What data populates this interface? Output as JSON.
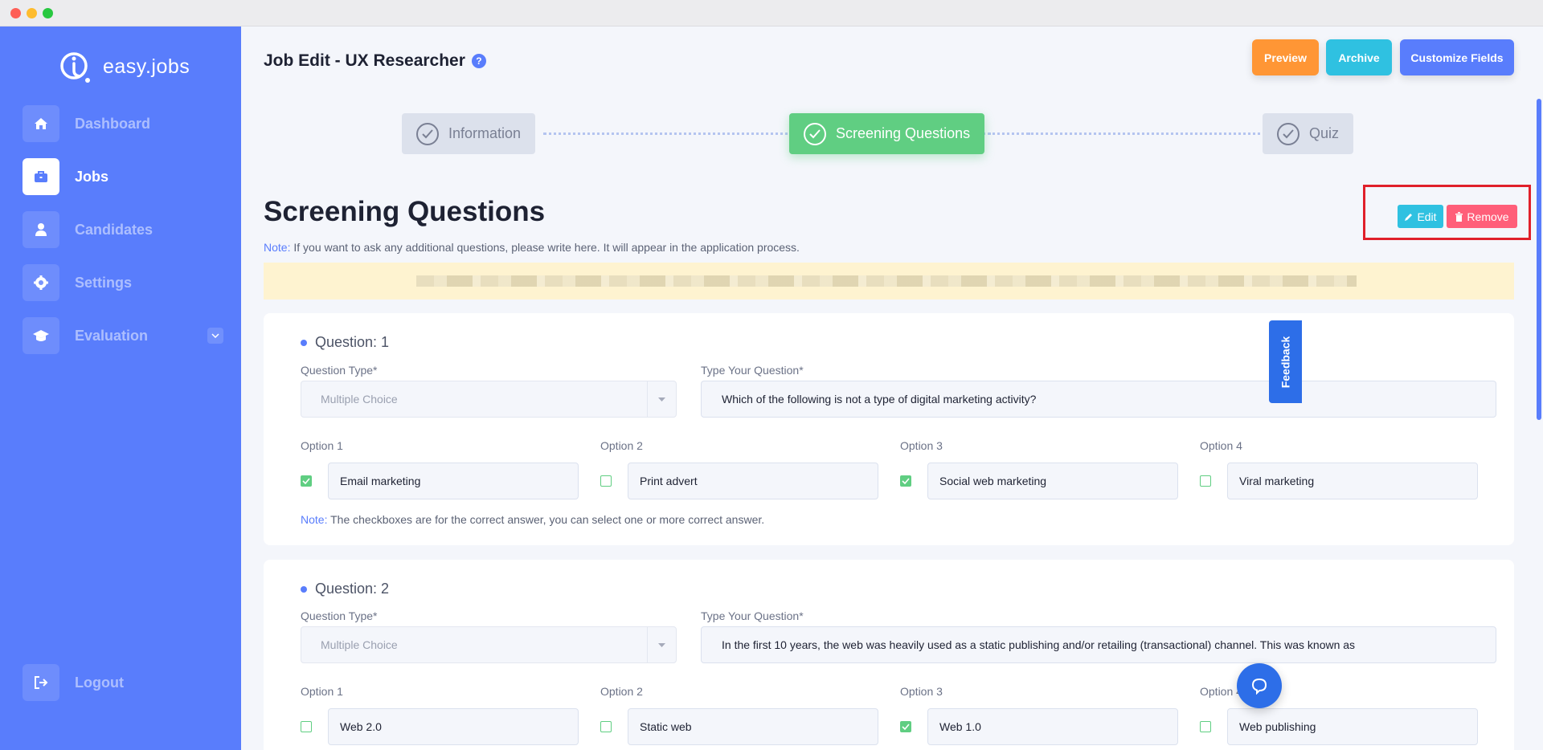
{
  "brand": {
    "name": "easy.jobs"
  },
  "sidebar": {
    "items": [
      {
        "label": "Dashboard",
        "icon": "home-icon"
      },
      {
        "label": "Jobs",
        "icon": "briefcase-icon"
      },
      {
        "label": "Candidates",
        "icon": "user-icon"
      },
      {
        "label": "Settings",
        "icon": "gear-icon"
      },
      {
        "label": "Evaluation",
        "icon": "graduation-cap-icon"
      }
    ],
    "logout": "Logout",
    "active": "Jobs"
  },
  "header": {
    "title": "Job Edit - UX Researcher",
    "help": "?",
    "buttons": {
      "preview": "Preview",
      "archive": "Archive",
      "customize": "Customize Fields"
    }
  },
  "steps": [
    {
      "label": "Information",
      "state": "inactive"
    },
    {
      "label": "Screening Questions",
      "state": "active"
    },
    {
      "label": "Quiz",
      "state": "inactive"
    }
  ],
  "section": {
    "title": "Screening Questions",
    "note_label": "Note:",
    "note_text": " If you want to ask any additional questions, please write here. It will appear in the application process.",
    "edit": "Edit",
    "remove": "Remove"
  },
  "questions": [
    {
      "heading": "Question: 1",
      "type_label": "Question Type*",
      "type_value": "Multiple Choice",
      "question_label": "Type Your Question*",
      "question_value": "Which of the following is not a type of digital marketing activity?",
      "options": [
        {
          "label": "Option 1",
          "value": "Email marketing",
          "checked": true
        },
        {
          "label": "Option 2",
          "value": "Print advert",
          "checked": false
        },
        {
          "label": "Option 3",
          "value": "Social web marketing",
          "checked": true
        },
        {
          "label": "Option 4",
          "value": "Viral marketing",
          "checked": false
        }
      ],
      "note_label": "Note:",
      "note_text": " The checkboxes are for the correct answer, you can select one or more correct answer."
    },
    {
      "heading": "Question: 2",
      "type_label": "Question Type*",
      "type_value": "Multiple Choice",
      "question_label": "Type Your Question*",
      "question_value": "In the first 10 years, the web was heavily used as a static publishing and/or retailing (transactional) channel. This was known as",
      "options": [
        {
          "label": "Option 1",
          "value": "Web 2.0",
          "checked": false
        },
        {
          "label": "Option 2",
          "value": "Static web",
          "checked": false
        },
        {
          "label": "Option 3",
          "value": "Web 1.0",
          "checked": true
        },
        {
          "label": "Option 4",
          "value": "Web publishing",
          "checked": false
        }
      ]
    }
  ],
  "widgets": {
    "feedback": "Feedback"
  },
  "colors": {
    "primary": "#597dfc",
    "success": "#60ce82",
    "warning": "#ff9635",
    "info": "#2fc1e1",
    "danger": "#ff5e79"
  }
}
